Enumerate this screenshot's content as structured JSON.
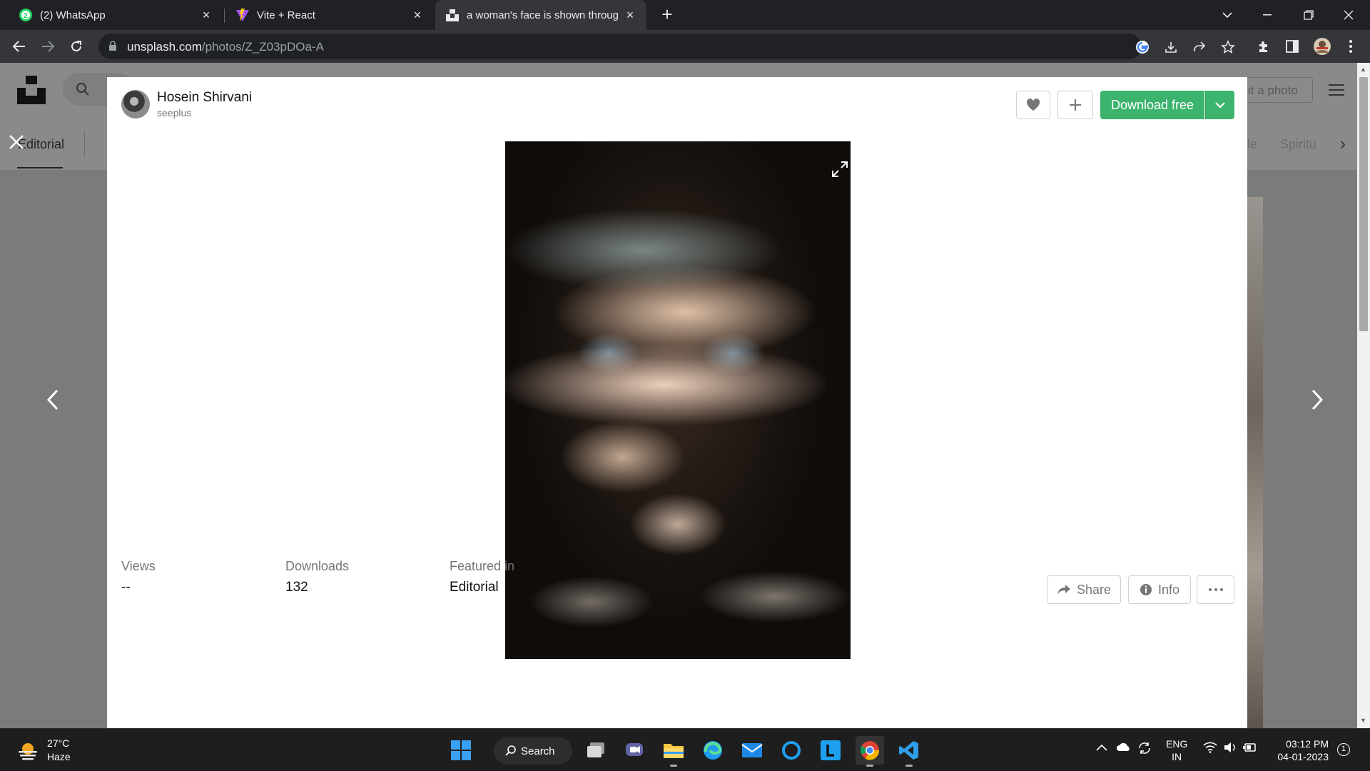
{
  "browser": {
    "tabs": [
      {
        "title": "(2) WhatsApp",
        "badge": "2"
      },
      {
        "title": "Vite + React"
      },
      {
        "title": "a woman's face is shown through"
      }
    ],
    "url_domain": "unsplash.com",
    "url_path": "/photos/Z_Z03pDOa-A"
  },
  "background_page": {
    "submit_label": "it a photo",
    "nav_tab_active": "Editorial",
    "topics": [
      "le",
      "Spiritu"
    ]
  },
  "modal": {
    "author": {
      "name": "Hosein Shirvani",
      "username": "seeplus"
    },
    "download_label": "Download free",
    "photo_alt": "a woman's face is shown through the shadows",
    "stats": [
      {
        "label": "Views",
        "value": "--"
      },
      {
        "label": "Downloads",
        "value": "132"
      },
      {
        "label": "Featured in",
        "value": "Editorial"
      }
    ],
    "share_label": "Share",
    "info_label": "Info"
  },
  "taskbar": {
    "weather": {
      "temp": "27°C",
      "condition": "Haze"
    },
    "search_label": "Search",
    "lang_line1": "ENG",
    "lang_line2": "IN",
    "time": "03:12 PM",
    "date": "04-01-2023",
    "notification_count": "1"
  },
  "colors": {
    "accent_green": "#3cb46e",
    "chrome_dark": "#202124",
    "chrome_toolbar": "#35363a"
  }
}
